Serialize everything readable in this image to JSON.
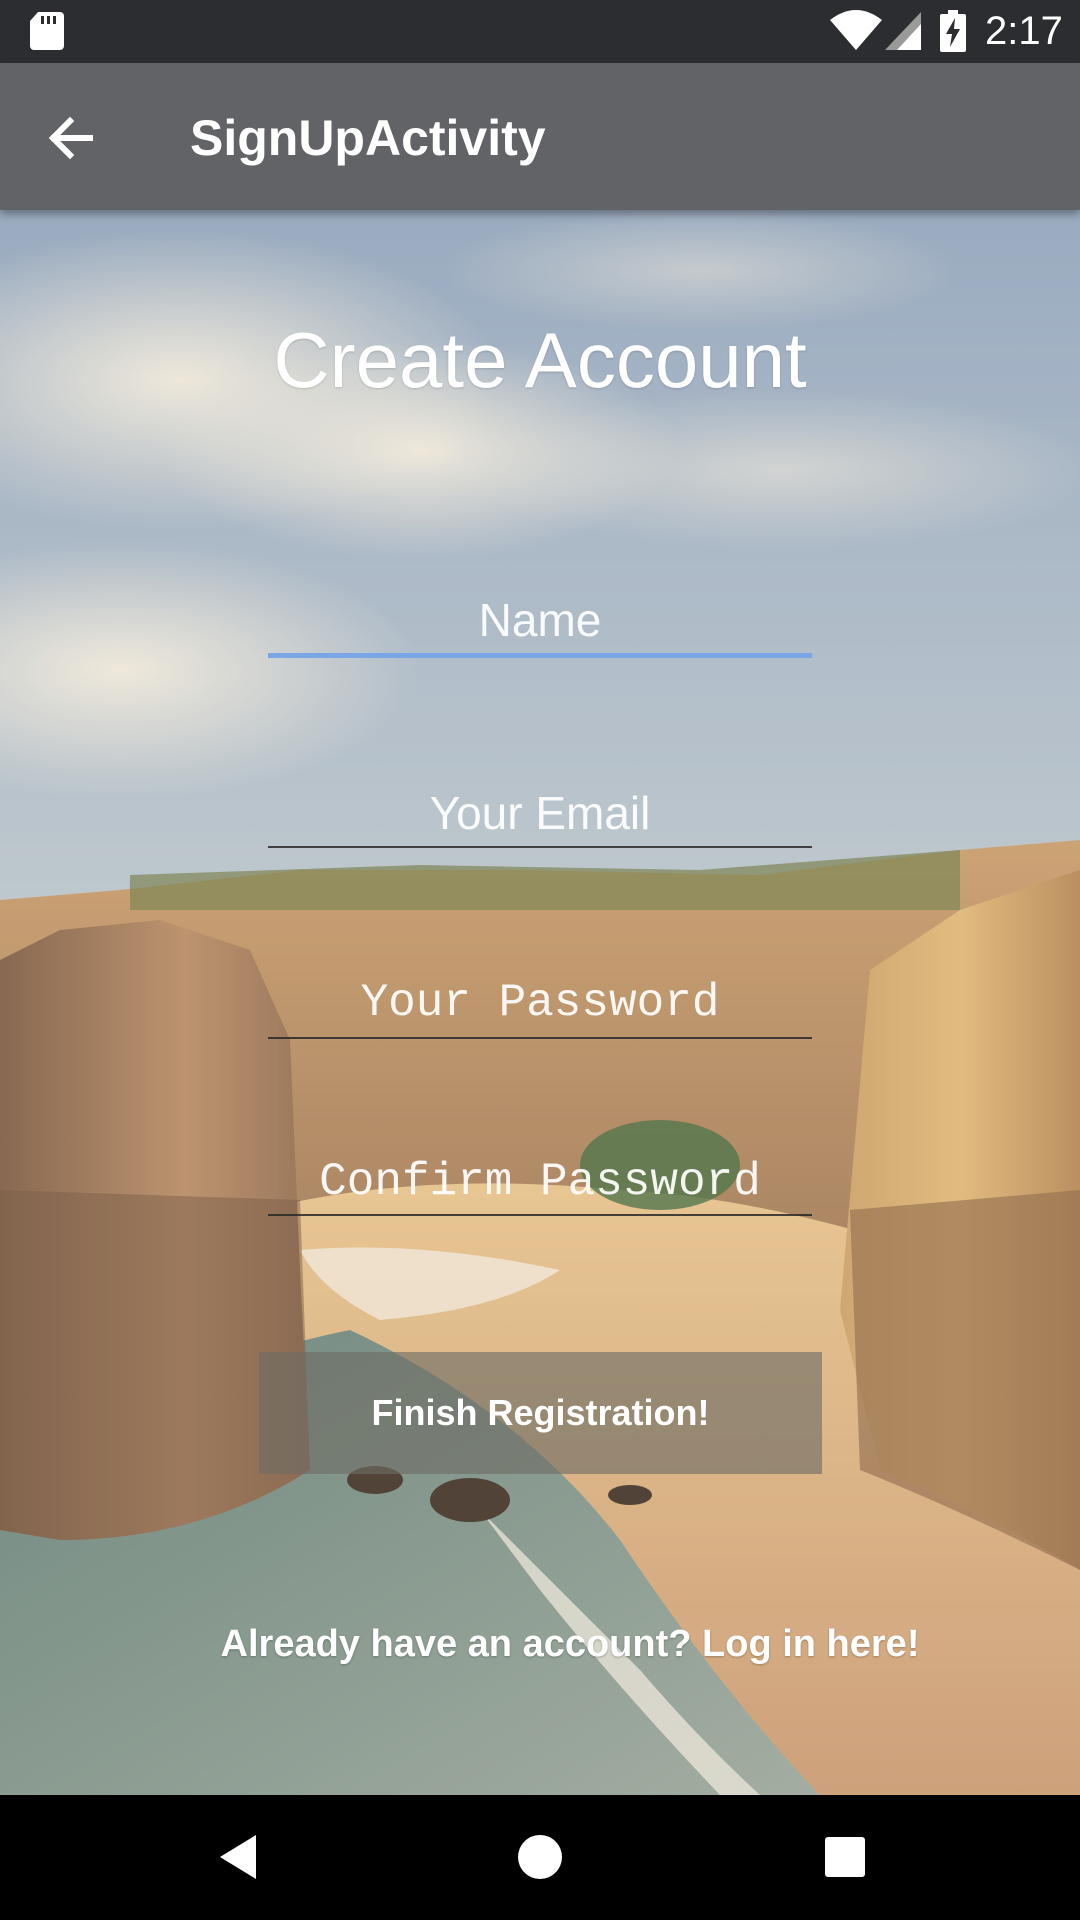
{
  "status_bar": {
    "time": "2:17",
    "icons": [
      "sd-card-icon",
      "wifi-icon",
      "cell-signal-icon",
      "battery-charging-icon"
    ]
  },
  "app_bar": {
    "title": "SignUpActivity",
    "back_icon": "arrow-back-icon"
  },
  "form": {
    "title": "Create Account",
    "fields": [
      {
        "name": "name",
        "placeholder": "Name",
        "value": "",
        "focused": true
      },
      {
        "name": "email",
        "placeholder": "Your Email",
        "value": ""
      },
      {
        "name": "password",
        "placeholder": "Your Password",
        "value": ""
      },
      {
        "name": "confirm_password",
        "placeholder": "Confirm Password",
        "value": ""
      }
    ],
    "submit_label": "Finish Registration!",
    "login_link": "Already have an account? Log in here!"
  },
  "nav_bar": {
    "icons": [
      "nav-back-icon",
      "nav-home-icon",
      "nav-recents-icon"
    ]
  },
  "colors": {
    "status_bar": "#2b2d30",
    "app_bar": "#616366",
    "focus_underline": "#7aa5e6",
    "text": "#ffffff"
  }
}
